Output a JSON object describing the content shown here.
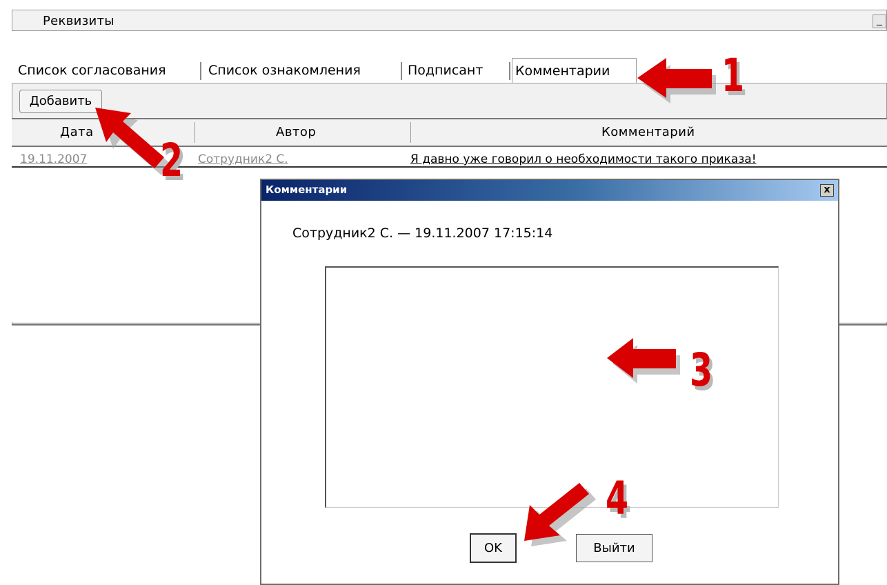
{
  "header": {
    "title": "Реквизиты",
    "minimize_label": "_"
  },
  "tabs": [
    {
      "label": "Список согласования"
    },
    {
      "label": "Список ознакомления"
    },
    {
      "label": "Подписант"
    },
    {
      "label": "Комментарии",
      "active": true
    }
  ],
  "toolbar": {
    "add_label": "Добавить"
  },
  "table": {
    "columns": [
      "Дата",
      "Автор",
      "Комментарий"
    ],
    "rows": [
      {
        "date": "19.11.2007",
        "author": "Сотрудник2 С.",
        "comment": "Я давно уже говорил о необходимости такого приказа!"
      }
    ]
  },
  "dialog": {
    "title": "Комментарии",
    "close_label": "x",
    "subtitle": "Сотрудник2 С. — 19.11.2007 17:15:14",
    "textarea_value": "",
    "ok_label": "OK",
    "exit_label": "Выйти"
  },
  "annotations": [
    {
      "number": "1",
      "target": "tab-comments"
    },
    {
      "number": "2",
      "target": "add-button"
    },
    {
      "number": "3",
      "target": "comment-textarea"
    },
    {
      "number": "4",
      "target": "ok-button"
    }
  ],
  "colors": {
    "arrow_red": "#d80000",
    "titlebar_dark": "#0a246a",
    "titlebar_light": "#a6caf0",
    "panel_bg": "#f1f1f1"
  }
}
